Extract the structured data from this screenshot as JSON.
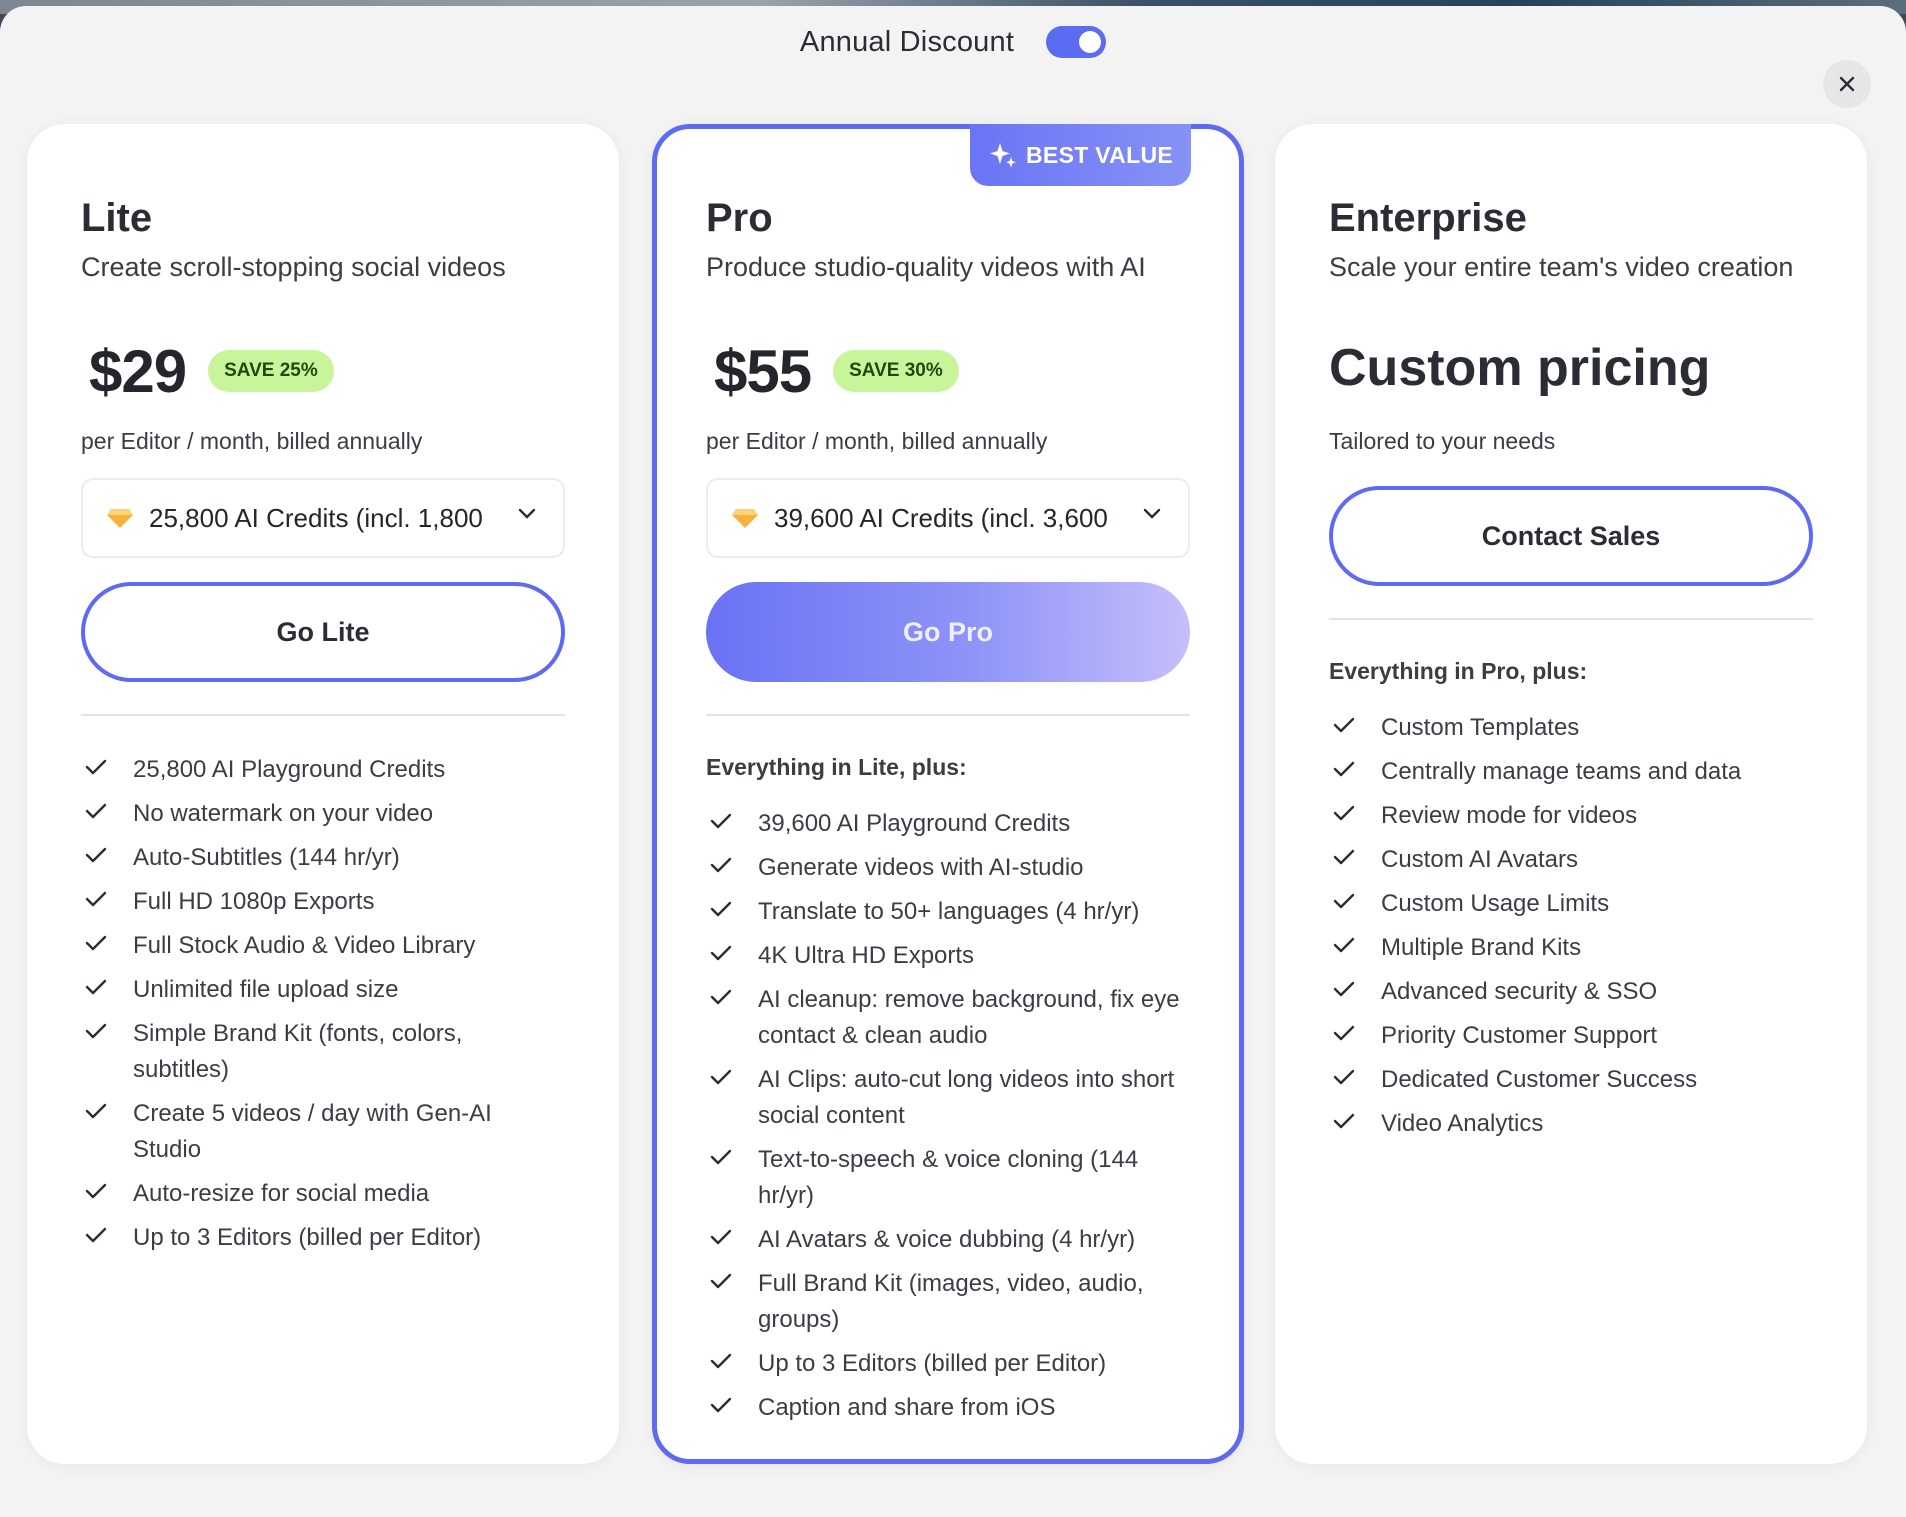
{
  "header": {
    "toggle_label": "Annual Discount",
    "toggle_on": true,
    "close_icon": "close-icon"
  },
  "colors": {
    "accent": "#5e6af1",
    "save_badge_bg": "#c9f59a",
    "modal_bg": "#f3f3f4"
  },
  "plans": {
    "lite": {
      "name": "Lite",
      "description": "Create scroll-stopping social videos",
      "price": "$29",
      "save_badge": "SAVE 25%",
      "billing": "per Editor / month, billed annually",
      "credits": "25,800 AI Credits (incl. 1,800",
      "cta": "Go Lite",
      "features": [
        "25,800 AI Playground Credits",
        "No watermark on your video",
        "Auto-Subtitles (144 hr/yr)",
        "Full HD 1080p Exports",
        "Full Stock Audio & Video Library",
        "Unlimited file upload size",
        "Simple Brand Kit (fonts, colors, subtitles)",
        "Create 5 videos / day with Gen-AI Studio",
        "Auto-resize for social media",
        "Up to 3 Editors (billed per Editor)"
      ]
    },
    "pro": {
      "badge": "BEST VALUE",
      "name": "Pro",
      "description": "Produce studio-quality videos with AI",
      "price": "$55",
      "save_badge": "SAVE 30%",
      "billing": "per Editor / month, billed annually",
      "credits": "39,600 AI Credits (incl. 3,600",
      "cta": "Go Pro",
      "features_heading": "Everything in Lite, plus:",
      "features": [
        "39,600 AI Playground Credits",
        "Generate videos with AI-studio",
        "Translate to 50+ languages (4 hr/yr)",
        "4K Ultra HD Exports",
        "AI cleanup: remove background, fix eye contact & clean audio",
        "AI Clips: auto-cut long videos into short social content",
        "Text-to-speech & voice cloning (144 hr/yr)",
        "AI Avatars & voice dubbing (4 hr/yr)",
        "Full Brand Kit (images, video, audio, groups)",
        "Up to 3 Editors (billed per Editor)",
        "Caption and share from iOS"
      ]
    },
    "enterprise": {
      "name": "Enterprise",
      "description": "Scale your entire team's video creation",
      "price": "Custom pricing",
      "billing": "Tailored to your needs",
      "cta": "Contact Sales",
      "features_heading": "Everything in Pro, plus:",
      "features": [
        "Custom Templates",
        "Centrally manage teams and data",
        "Review mode for videos",
        "Custom AI Avatars",
        "Custom Usage Limits",
        "Multiple Brand Kits",
        "Advanced security & SSO",
        "Priority Customer Support",
        "Dedicated Customer Success",
        "Video Analytics"
      ]
    }
  }
}
